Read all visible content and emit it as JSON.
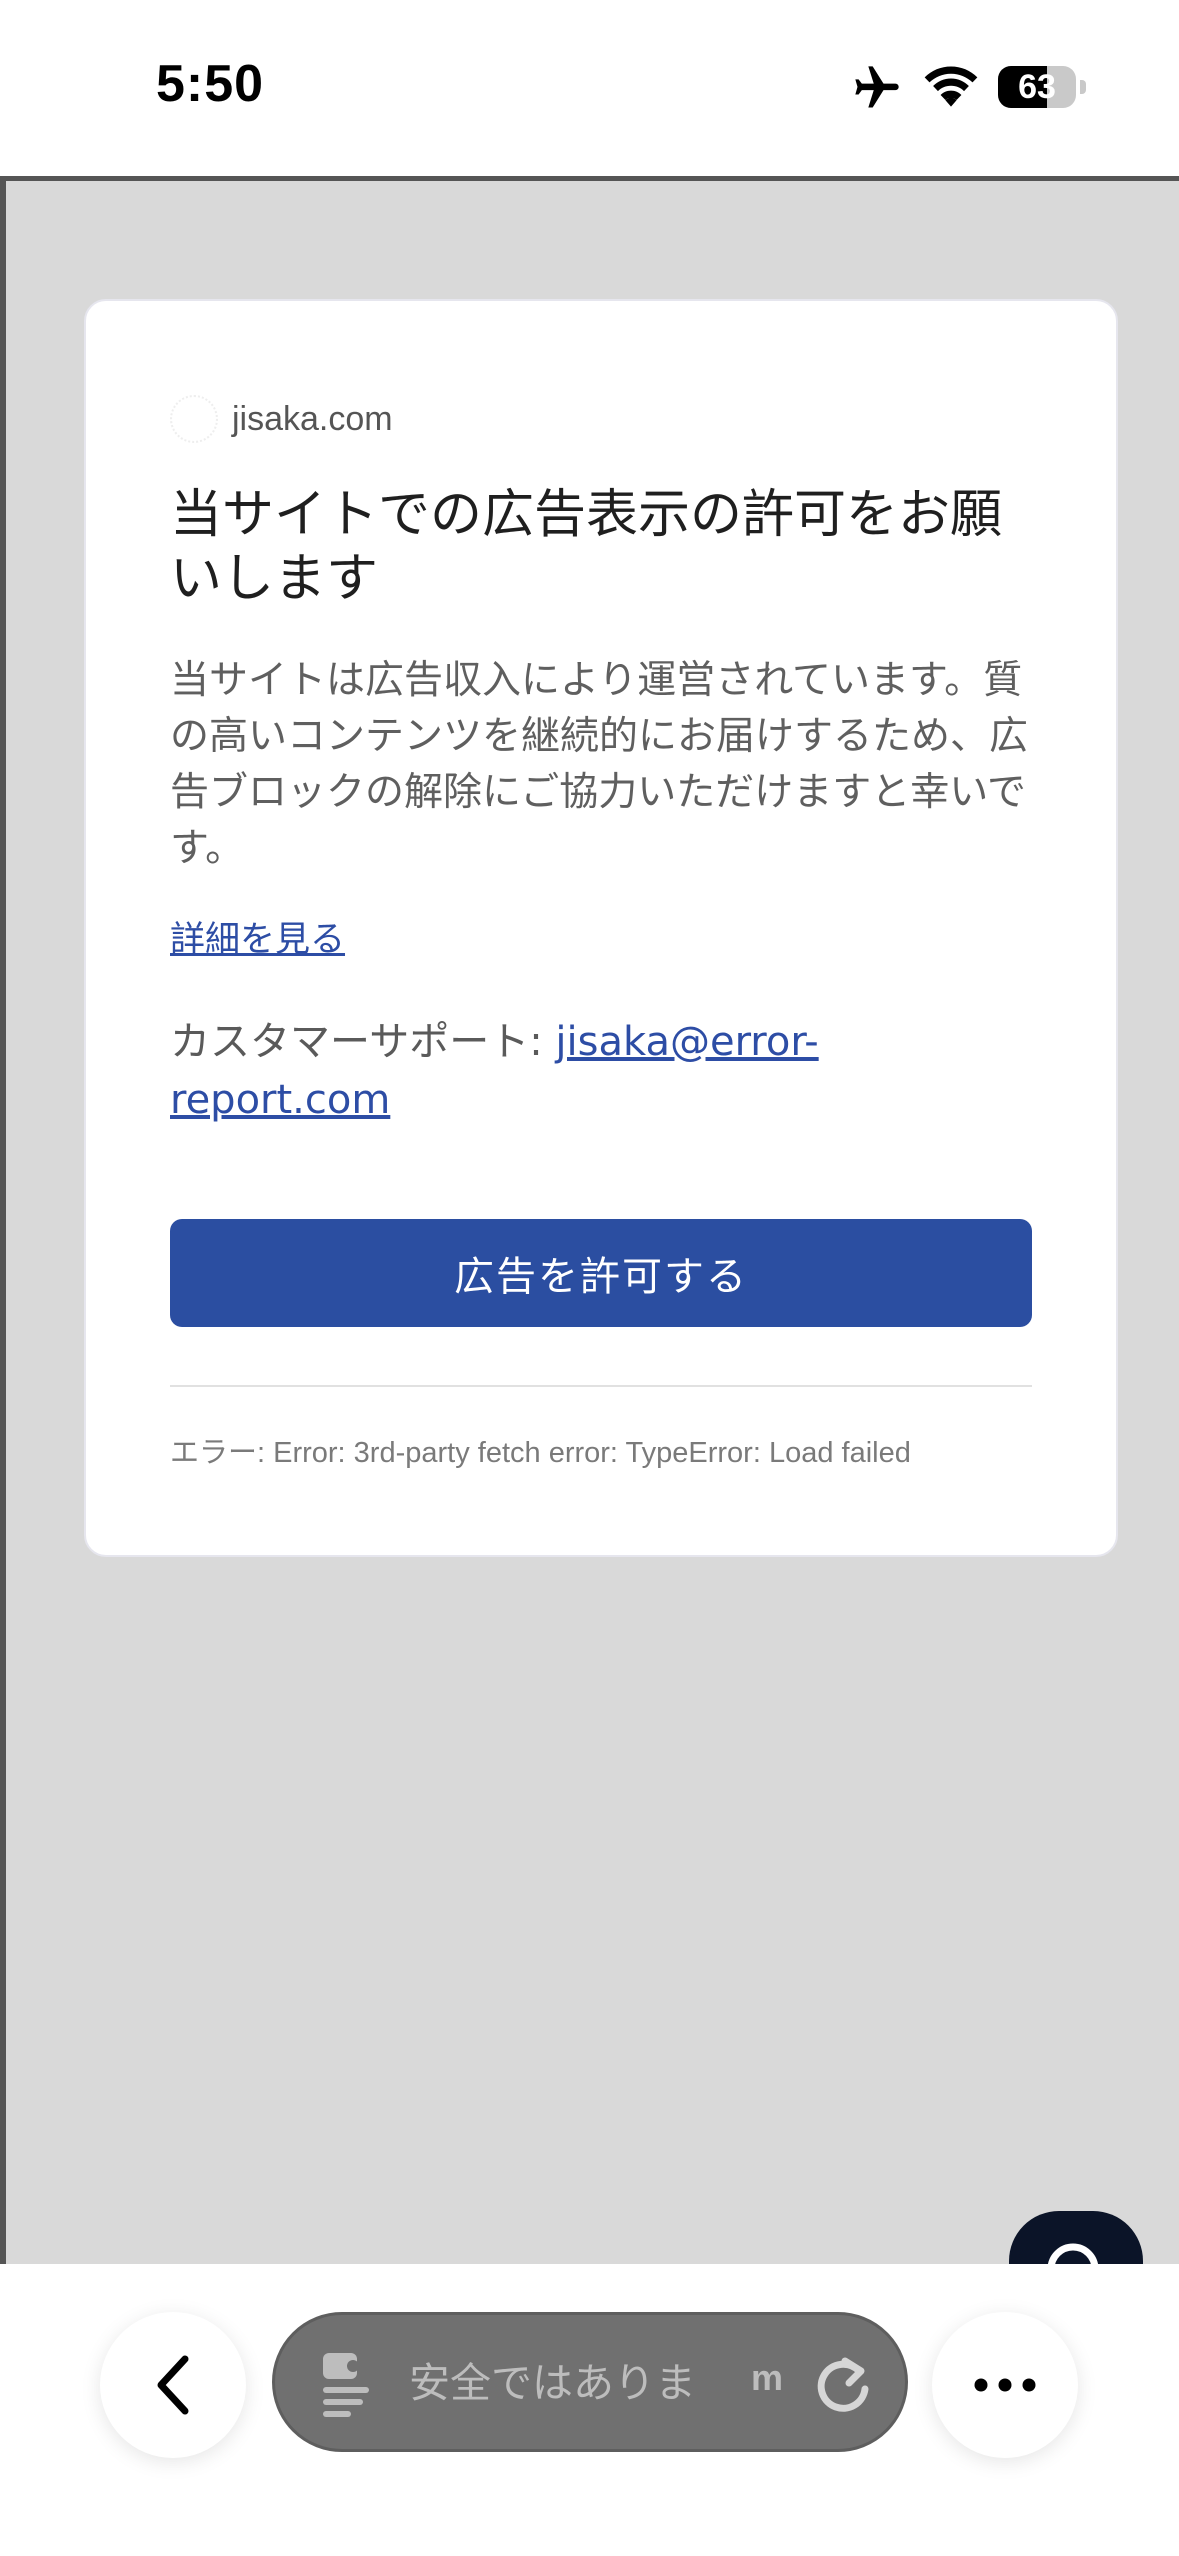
{
  "status_bar": {
    "time": "5:50",
    "battery_level": "63",
    "icons": [
      "airplane-icon",
      "wifi-icon",
      "battery-icon"
    ]
  },
  "dialog": {
    "site_domain": "jisaka.com",
    "title": "当サイトでの広告表示の許可をお願いします",
    "body": "当サイトは広告収入により運営されています。質の高いコンテンツを継続的にお届けするため、広告ブロックの解除にご協力いただけますと幸いです。",
    "details_link": "詳細を見る",
    "support_label": "カスタマーサポート: ",
    "support_email": "jisaka@error-report.com",
    "allow_button": "広告を許可する",
    "error_message": "エラー: Error: 3rd-party fetch error: TypeError: Load failed"
  },
  "browser_toolbar": {
    "address_text": "安全ではありま",
    "address_tail": "m",
    "icons": [
      "back-chevron-icon",
      "reader-icon",
      "reload-icon",
      "more-icon",
      "search-icon"
    ]
  },
  "colors": {
    "accent": "#2b4ea1",
    "link": "#2d4da5",
    "page_background": "#d9d9d9"
  }
}
